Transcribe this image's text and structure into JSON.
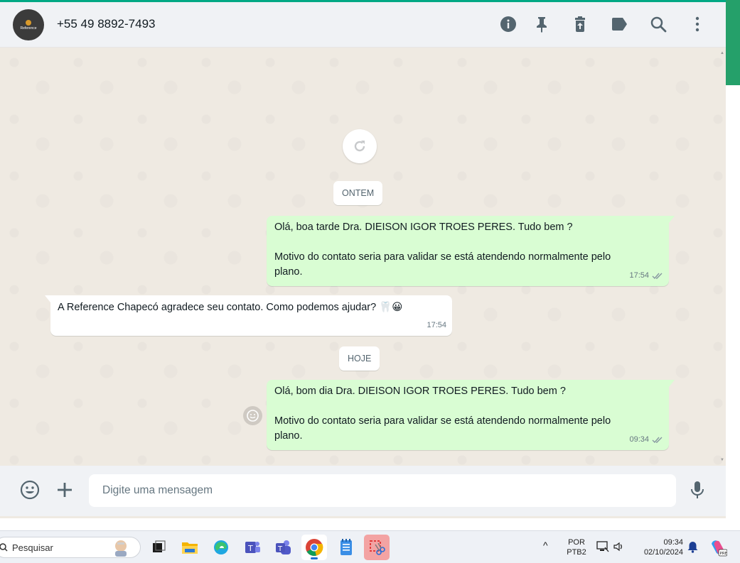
{
  "colors": {
    "accent": "#00a884",
    "outgoing": "#d9fdd3",
    "incoming": "#ffffff",
    "chat_bg": "#efeae2",
    "header_bg": "#f0f2f5"
  },
  "header": {
    "avatar_text": "Reference",
    "contact_name": "+55 49 8892-7493",
    "icons": [
      "info-icon",
      "pin-icon",
      "delete-icon",
      "label-icon",
      "search-icon",
      "menu-icon"
    ]
  },
  "chat": {
    "day_yesterday": "ONTEM",
    "day_today": "HOJE",
    "messages": [
      {
        "direction": "out",
        "lines": [
          "Olá, boa tarde Dra. DIEISON IGOR TROES PERES. Tudo bem ?",
          "",
          "Motivo do contato seria para validar se está atendendo normalmente pelo",
          "plano."
        ],
        "time": "17:54",
        "status": "read"
      },
      {
        "direction": "in",
        "lines": [
          "A Reference Chapecó agradece seu contato. Como podemos ajudar? 🦷😀"
        ],
        "time": "17:54"
      },
      {
        "direction": "out",
        "lines": [
          "Olá, bom dia Dra. DIEISON IGOR TROES PERES. Tudo bem ?",
          "",
          "Motivo do contato seria para validar se está atendendo normalmente pelo",
          "plano."
        ],
        "time": "09:34",
        "status": "read"
      }
    ]
  },
  "composer": {
    "placeholder": "Digite uma mensagem"
  },
  "taskbar": {
    "search_label": "Pesquisar",
    "language": "POR",
    "keyboard": "PTB2",
    "time": "09:34",
    "date": "02/10/2024",
    "apps": [
      "task-view",
      "file-explorer",
      "edge",
      "teams-classic",
      "teams",
      "chrome",
      "notepad",
      "snipping-tool"
    ],
    "active_app": "chrome"
  }
}
